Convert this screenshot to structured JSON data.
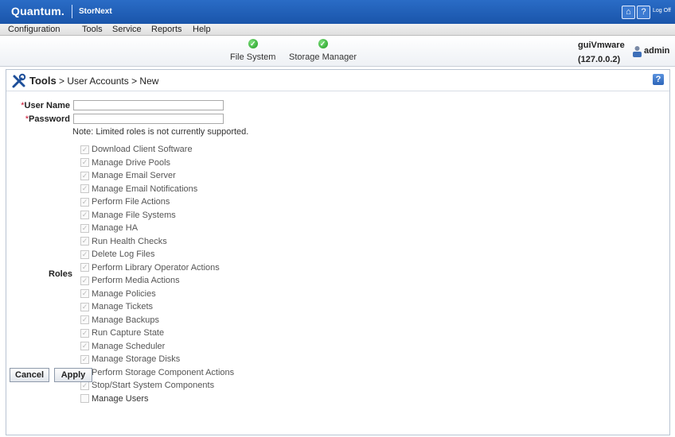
{
  "app": {
    "brand": "Quantum.",
    "product": "StorNext",
    "logoff_label": "Log Off"
  },
  "menu": [
    "Configuration",
    "Tools",
    "Service",
    "Reports",
    "Help"
  ],
  "status": {
    "services": [
      {
        "label": "File System",
        "state": "ok"
      },
      {
        "label": "Storage Manager",
        "state": "ok"
      }
    ],
    "server_name": "guiVmware",
    "server_ip": "(127.0.0.2)",
    "username": "admin"
  },
  "page": {
    "breadcrumb_root": "Tools",
    "breadcrumb_rest": "> User Accounts > New"
  },
  "form": {
    "username_label": "User Name",
    "password_label": "Password",
    "required_mark": "*",
    "username_value": "",
    "password_value": "",
    "note": "Note: Limited roles is not currently supported.",
    "roles_label": "Roles",
    "roles": [
      {
        "label": "Download Client Software",
        "checked": true
      },
      {
        "label": "Manage Drive Pools",
        "checked": true
      },
      {
        "label": "Manage Email Server",
        "checked": true
      },
      {
        "label": "Manage Email Notifications",
        "checked": true
      },
      {
        "label": "Perform File Actions",
        "checked": true
      },
      {
        "label": "Manage File Systems",
        "checked": true
      },
      {
        "label": "Manage HA",
        "checked": true
      },
      {
        "label": "Run Health Checks",
        "checked": true
      },
      {
        "label": "Delete Log Files",
        "checked": true
      },
      {
        "label": "Perform Library Operator Actions",
        "checked": true
      },
      {
        "label": "Perform Media Actions",
        "checked": true
      },
      {
        "label": "Manage Policies",
        "checked": true
      },
      {
        "label": "Manage Tickets",
        "checked": true
      },
      {
        "label": "Manage Backups",
        "checked": true
      },
      {
        "label": "Run Capture State",
        "checked": true
      },
      {
        "label": "Manage Scheduler",
        "checked": true
      },
      {
        "label": "Manage Storage Disks",
        "checked": true
      },
      {
        "label": "Perform Storage Component Actions",
        "checked": true
      },
      {
        "label": "Stop/Start System Components",
        "checked": true
      },
      {
        "label": "Manage Users",
        "checked": false
      }
    ]
  },
  "buttons": {
    "cancel": "Cancel",
    "apply": "Apply"
  }
}
